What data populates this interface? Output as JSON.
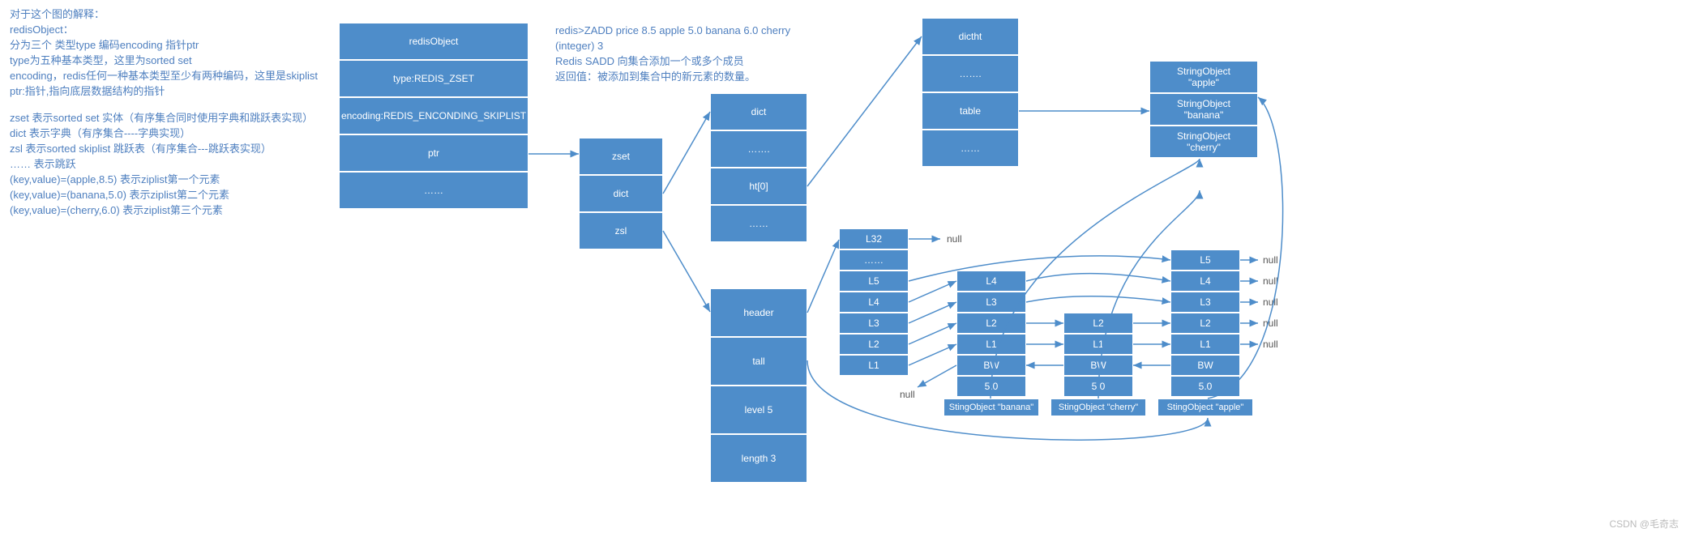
{
  "explanation": {
    "l1": "对于这个图的解释：",
    "l2": "redisObject：",
    "l3": "分为三个 类型type 编码encoding 指针ptr",
    "l4": "type为五种基本类型，这里为sorted set",
    "l5": "encoding，redis任何一种基本类型至少有两种编码，这里是skiplist",
    "l6": "ptr:指针,指向底层数据结构的指针",
    "l7": "zset   表示sorted set 实体（有序集合同时使用字典和跳跃表实现）",
    "l8": "dict  表示字典（有序集合----字典实现）",
    "l9": "zsl  表示sorted skiplist 跳跃表（有序集合---跳跃表实现）",
    "l10": "…… 表示跳跃",
    "l11": "(key,value)=(apple,8.5)          表示ziplist第一个元素",
    "l12": "(key,value)=(banana,5.0)        表示ziplist第二个元素",
    "l13": "(key,value)=(cherry,6.0)          表示ziplist第三个元素"
  },
  "command": {
    "c1": "redis>ZADD  price  8.5   apple  5.0  banana  6.0  cherry",
    "c2": "(integer) 3",
    "c3": "Redis SADD 向集合添加一个或多个成员",
    "c4": "返回值：被添加到集合中的新元素的数量。"
  },
  "redisObject": [
    "redisObject",
    "type:REDIS_ZSET",
    "encoding:REDIS_ENCONDING_SKIPLIST",
    "ptr",
    "……"
  ],
  "zset": [
    "zset",
    "dict",
    "zsl"
  ],
  "dict": [
    "dict",
    "…….",
    "ht[0]",
    "……"
  ],
  "dictht": [
    "dictht",
    "…….",
    "table",
    "……"
  ],
  "strings": [
    "StringObject",
    "\"apple\"",
    "StringObject",
    "\"banana\"",
    "StringObject",
    "\"cherry\""
  ],
  "skipHead": [
    "L32",
    "……",
    "L5",
    "L4",
    "L3",
    "L2",
    "L1"
  ],
  "skipBody": [
    "header",
    "tall",
    "level 5",
    "length 3"
  ],
  "node1": [
    "L4",
    "L3",
    "L2",
    "L1",
    "BW",
    "5.0"
  ],
  "node1Label": "StingObject  \"banana\"",
  "node2": [
    "L2",
    "L1",
    "BW",
    "5.0"
  ],
  "node2Label": "StingObject  \"cherry\"",
  "node3": [
    "L5",
    "L4",
    "L3",
    "L2",
    "L1",
    "BW",
    "5.0"
  ],
  "node3Label": "StingObject  \"apple\"",
  "nulls": [
    "null",
    "null",
    "null",
    "null",
    "null",
    "null",
    "null"
  ],
  "watermark": "CSDN @毛奇志"
}
